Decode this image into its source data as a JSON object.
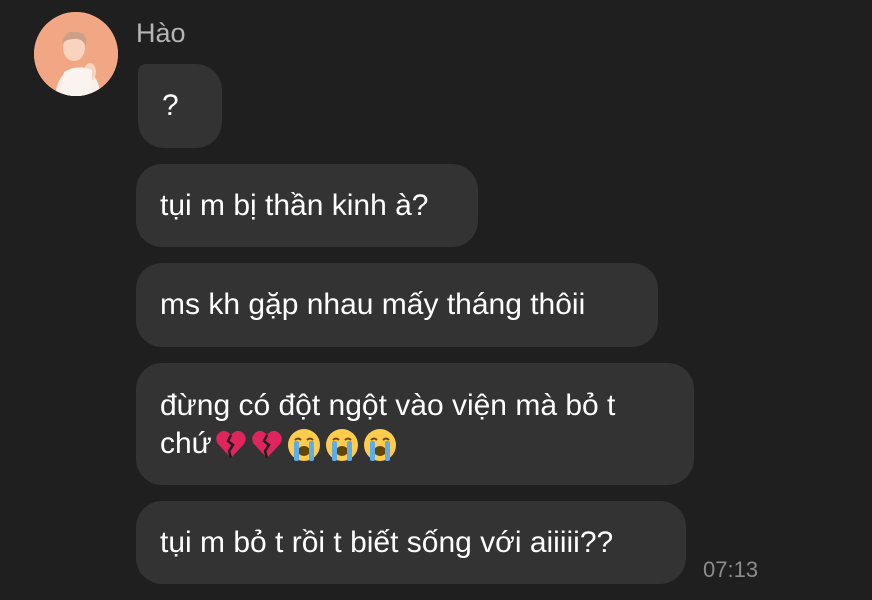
{
  "chat": {
    "sender_name": "Hào",
    "avatar_icon": "profile-photo",
    "messages": [
      {
        "text": "?"
      },
      {
        "text": "tụi m bị thần kinh à?"
      },
      {
        "text": "ms kh gặp nhau mấy tháng thôii"
      },
      {
        "line1": "đừng có đột ngột vào viện mà bỏ t",
        "line2": "chứ",
        "emojis": [
          "broken-heart",
          "broken-heart",
          "loudly-crying-face",
          "loudly-crying-face",
          "loudly-crying-face"
        ]
      },
      {
        "text": "tụi m bỏ t rồi t biết sống với aiiiii??"
      }
    ],
    "timestamp": "07:13"
  },
  "colors": {
    "background": "#1f1f1f",
    "bubble": "#333333",
    "text": "#ffffff",
    "muted_text": "#b5b5b5"
  }
}
